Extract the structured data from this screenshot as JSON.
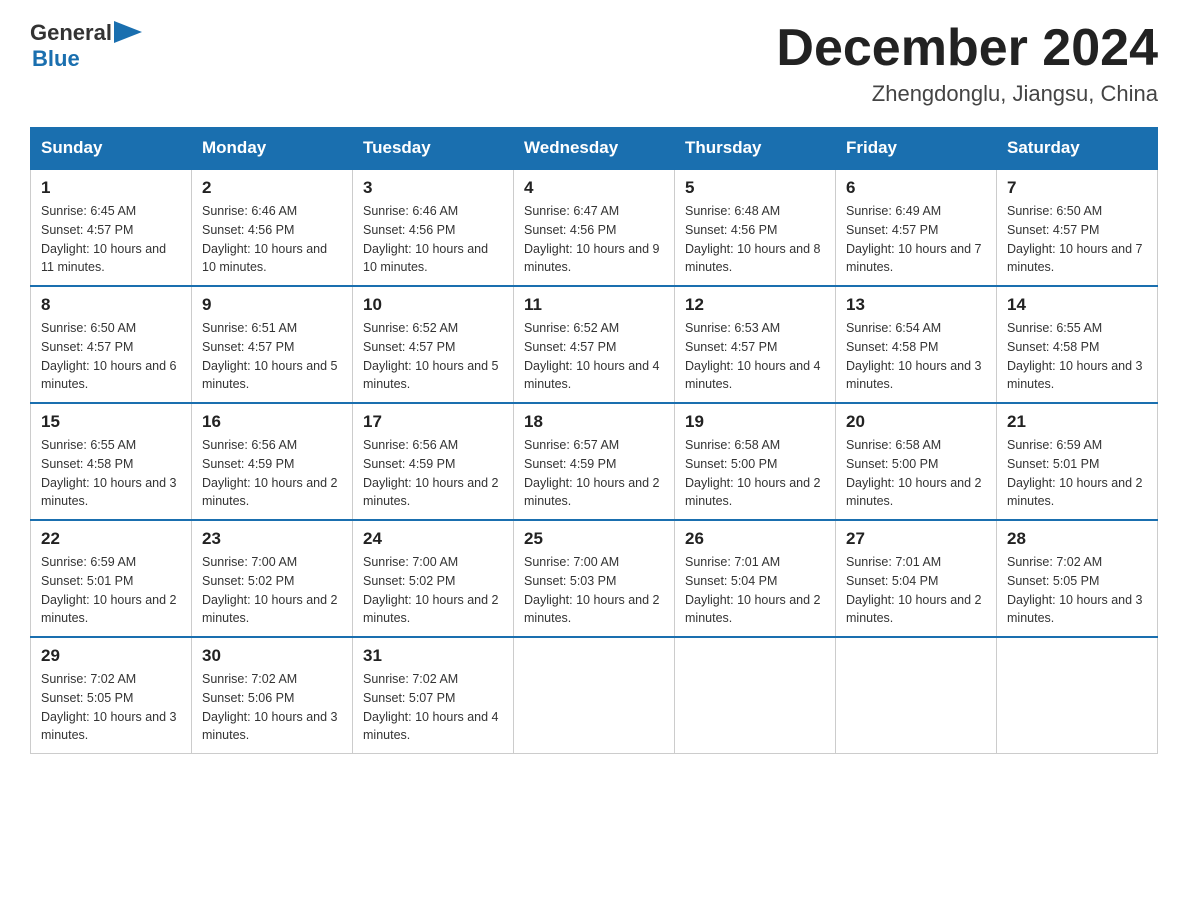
{
  "header": {
    "logo": {
      "part1": "General",
      "part2": "Blue"
    },
    "title": "December 2024",
    "location": "Zhengdonglu, Jiangsu, China"
  },
  "weekdays": [
    "Sunday",
    "Monday",
    "Tuesday",
    "Wednesday",
    "Thursday",
    "Friday",
    "Saturday"
  ],
  "weeks": [
    [
      {
        "day": "1",
        "sunrise": "6:45 AM",
        "sunset": "4:57 PM",
        "daylight": "10 hours and 11 minutes."
      },
      {
        "day": "2",
        "sunrise": "6:46 AM",
        "sunset": "4:56 PM",
        "daylight": "10 hours and 10 minutes."
      },
      {
        "day": "3",
        "sunrise": "6:46 AM",
        "sunset": "4:56 PM",
        "daylight": "10 hours and 10 minutes."
      },
      {
        "day": "4",
        "sunrise": "6:47 AM",
        "sunset": "4:56 PM",
        "daylight": "10 hours and 9 minutes."
      },
      {
        "day": "5",
        "sunrise": "6:48 AM",
        "sunset": "4:56 PM",
        "daylight": "10 hours and 8 minutes."
      },
      {
        "day": "6",
        "sunrise": "6:49 AM",
        "sunset": "4:57 PM",
        "daylight": "10 hours and 7 minutes."
      },
      {
        "day": "7",
        "sunrise": "6:50 AM",
        "sunset": "4:57 PM",
        "daylight": "10 hours and 7 minutes."
      }
    ],
    [
      {
        "day": "8",
        "sunrise": "6:50 AM",
        "sunset": "4:57 PM",
        "daylight": "10 hours and 6 minutes."
      },
      {
        "day": "9",
        "sunrise": "6:51 AM",
        "sunset": "4:57 PM",
        "daylight": "10 hours and 5 minutes."
      },
      {
        "day": "10",
        "sunrise": "6:52 AM",
        "sunset": "4:57 PM",
        "daylight": "10 hours and 5 minutes."
      },
      {
        "day": "11",
        "sunrise": "6:52 AM",
        "sunset": "4:57 PM",
        "daylight": "10 hours and 4 minutes."
      },
      {
        "day": "12",
        "sunrise": "6:53 AM",
        "sunset": "4:57 PM",
        "daylight": "10 hours and 4 minutes."
      },
      {
        "day": "13",
        "sunrise": "6:54 AM",
        "sunset": "4:58 PM",
        "daylight": "10 hours and 3 minutes."
      },
      {
        "day": "14",
        "sunrise": "6:55 AM",
        "sunset": "4:58 PM",
        "daylight": "10 hours and 3 minutes."
      }
    ],
    [
      {
        "day": "15",
        "sunrise": "6:55 AM",
        "sunset": "4:58 PM",
        "daylight": "10 hours and 3 minutes."
      },
      {
        "day": "16",
        "sunrise": "6:56 AM",
        "sunset": "4:59 PM",
        "daylight": "10 hours and 2 minutes."
      },
      {
        "day": "17",
        "sunrise": "6:56 AM",
        "sunset": "4:59 PM",
        "daylight": "10 hours and 2 minutes."
      },
      {
        "day": "18",
        "sunrise": "6:57 AM",
        "sunset": "4:59 PM",
        "daylight": "10 hours and 2 minutes."
      },
      {
        "day": "19",
        "sunrise": "6:58 AM",
        "sunset": "5:00 PM",
        "daylight": "10 hours and 2 minutes."
      },
      {
        "day": "20",
        "sunrise": "6:58 AM",
        "sunset": "5:00 PM",
        "daylight": "10 hours and 2 minutes."
      },
      {
        "day": "21",
        "sunrise": "6:59 AM",
        "sunset": "5:01 PM",
        "daylight": "10 hours and 2 minutes."
      }
    ],
    [
      {
        "day": "22",
        "sunrise": "6:59 AM",
        "sunset": "5:01 PM",
        "daylight": "10 hours and 2 minutes."
      },
      {
        "day": "23",
        "sunrise": "7:00 AM",
        "sunset": "5:02 PM",
        "daylight": "10 hours and 2 minutes."
      },
      {
        "day": "24",
        "sunrise": "7:00 AM",
        "sunset": "5:02 PM",
        "daylight": "10 hours and 2 minutes."
      },
      {
        "day": "25",
        "sunrise": "7:00 AM",
        "sunset": "5:03 PM",
        "daylight": "10 hours and 2 minutes."
      },
      {
        "day": "26",
        "sunrise": "7:01 AM",
        "sunset": "5:04 PM",
        "daylight": "10 hours and 2 minutes."
      },
      {
        "day": "27",
        "sunrise": "7:01 AM",
        "sunset": "5:04 PM",
        "daylight": "10 hours and 2 minutes."
      },
      {
        "day": "28",
        "sunrise": "7:02 AM",
        "sunset": "5:05 PM",
        "daylight": "10 hours and 3 minutes."
      }
    ],
    [
      {
        "day": "29",
        "sunrise": "7:02 AM",
        "sunset": "5:05 PM",
        "daylight": "10 hours and 3 minutes."
      },
      {
        "day": "30",
        "sunrise": "7:02 AM",
        "sunset": "5:06 PM",
        "daylight": "10 hours and 3 minutes."
      },
      {
        "day": "31",
        "sunrise": "7:02 AM",
        "sunset": "5:07 PM",
        "daylight": "10 hours and 4 minutes."
      },
      null,
      null,
      null,
      null
    ]
  ]
}
